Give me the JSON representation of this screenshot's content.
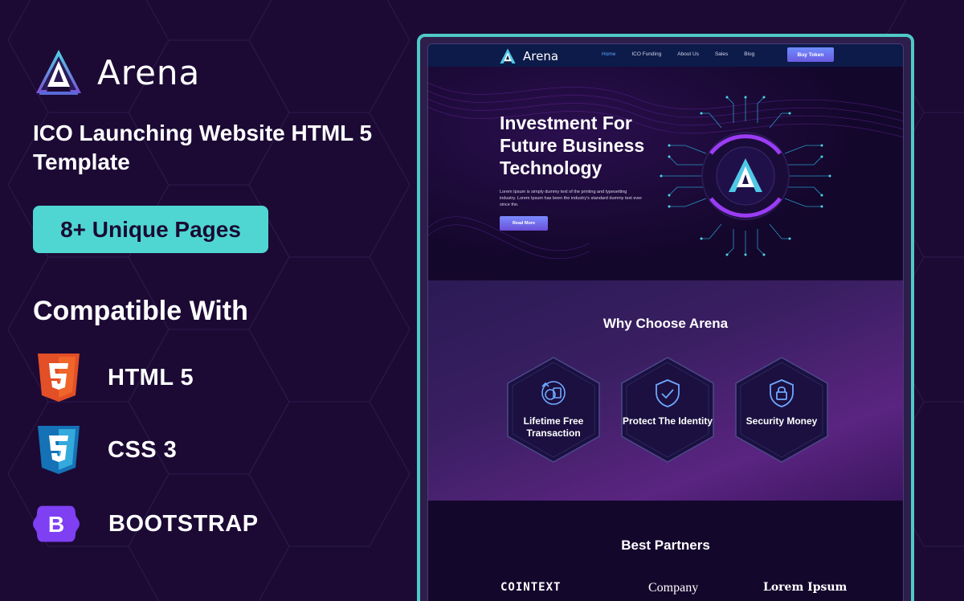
{
  "brand": {
    "name": "Arena"
  },
  "headline": "ICO Launching Website HTML 5 Template",
  "pages_badge": "8+ Unique Pages",
  "compat": {
    "title": "Compatible With",
    "items": [
      {
        "label": "HTML 5",
        "icon": "html5-icon"
      },
      {
        "label": "CSS 3",
        "icon": "css3-icon"
      },
      {
        "label": "BOOTSTRAP",
        "icon": "bootstrap-icon"
      }
    ]
  },
  "mockup": {
    "nav": {
      "brand": "Arena",
      "links": [
        "Home",
        "ICO Funding",
        "About Us",
        "Sales",
        "Blog"
      ],
      "cta": "Buy Token"
    },
    "hero": {
      "title": "Investment For Future Business Technology",
      "text": "Lorem Ipsum is simply dummy text of the printing and typesetting industry. Lorem Ipsum has been the industry's standard dummy text ever since the.",
      "button": "Read More"
    },
    "why": {
      "title": "Why Choose Arena",
      "cards": [
        {
          "label": "Lifetime Free Transaction",
          "icon": "coin-transfer-icon"
        },
        {
          "label": "Protect The Identity",
          "icon": "shield-check-icon"
        },
        {
          "label": "Security Money",
          "icon": "shield-lock-icon"
        }
      ]
    },
    "partners": {
      "title": "Best Partners",
      "logos": [
        "COINTEXT",
        "Company",
        "Lorem Ipsum"
      ]
    }
  },
  "colors": {
    "background": "#1c0a35",
    "accent": "#4fd6d3",
    "frame": "#4fc9c6",
    "purple": "#8b3cf0",
    "cyan": "#31c6e6"
  }
}
